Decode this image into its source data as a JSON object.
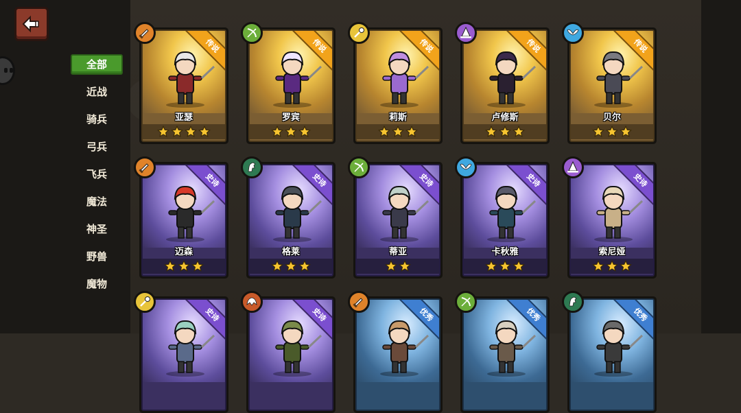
{
  "nav": {
    "back_icon": "back-arrow-icon"
  },
  "categories": [
    "全部",
    "近战",
    "骑兵",
    "弓兵",
    "飞兵",
    "魔法",
    "神圣",
    "野兽",
    "魔物"
  ],
  "active_category": 0,
  "colors": {
    "legend": "#f2a31b",
    "epic": "#7b4fcf",
    "good": "#3f7fd1",
    "category_active": "#4a9a2c"
  },
  "heroes": [
    {
      "name": "亚瑟",
      "rarity": "传说",
      "tier": "legend",
      "class_icon": "sword-icon",
      "stars": 4,
      "hair": "#e8e8e8",
      "outfit": "#8a2a2a"
    },
    {
      "name": "罗宾",
      "rarity": "传说",
      "tier": "legend",
      "class_icon": "bow-icon",
      "stars": 3,
      "hair": "#f0e6ff",
      "outfit": "#5a2a80"
    },
    {
      "name": "莉斯",
      "rarity": "传说",
      "tier": "legend",
      "class_icon": "holy-staff-icon",
      "stars": 3,
      "hair": "#c08ee0",
      "outfit": "#9a6ad0"
    },
    {
      "name": "卢修斯",
      "rarity": "传说",
      "tier": "legend",
      "class_icon": "wizard-hat-icon",
      "stars": 3,
      "hair": "#3a2a4a",
      "outfit": "#2a2030"
    },
    {
      "name": "贝尔",
      "rarity": "传说",
      "tier": "legend",
      "class_icon": "wings-icon",
      "stars": 3,
      "hair": "#7a7a80",
      "outfit": "#4a4a55"
    },
    {
      "name": "迈森",
      "rarity": "史诗",
      "tier": "epic",
      "class_icon": "sword-icon",
      "stars": 3,
      "hair": "#d83a2a",
      "outfit": "#2a2a2a"
    },
    {
      "name": "格莱",
      "rarity": "史诗",
      "tier": "epic",
      "class_icon": "horse-icon",
      "stars": 3,
      "hair": "#4a5058",
      "outfit": "#2a3a4a"
    },
    {
      "name": "蒂亚",
      "rarity": "史诗",
      "tier": "epic",
      "class_icon": "bow-icon",
      "stars": 2,
      "hair": "#c0d0c8",
      "outfit": "#3a3a4a"
    },
    {
      "name": "卡秋雅",
      "rarity": "史诗",
      "tier": "epic",
      "class_icon": "wings-icon",
      "stars": 3,
      "hair": "#5a5a6a",
      "outfit": "#2a4a5a"
    },
    {
      "name": "索尼娅",
      "rarity": "史诗",
      "tier": "epic",
      "class_icon": "wizard-hat-icon",
      "stars": 3,
      "hair": "#e8d8b8",
      "outfit": "#c8b088"
    },
    {
      "name": "",
      "rarity": "史诗",
      "tier": "epic",
      "class_icon": "holy-staff-icon",
      "stars": 0,
      "hair": "#9ad0c0",
      "outfit": "#5a6a8a"
    },
    {
      "name": "",
      "rarity": "史诗",
      "tier": "epic",
      "class_icon": "beast-icon",
      "stars": 0,
      "hair": "#7a8a4a",
      "outfit": "#4a5a2a"
    },
    {
      "name": "",
      "rarity": "优秀",
      "tier": "good",
      "class_icon": "sword-icon",
      "stars": 0,
      "hair": "#c89a6a",
      "outfit": "#6a4a3a"
    },
    {
      "name": "",
      "rarity": "优秀",
      "tier": "good",
      "class_icon": "bow-icon",
      "stars": 0,
      "hair": "#d8d0c0",
      "outfit": "#6a5a4a"
    },
    {
      "name": "",
      "rarity": "优秀",
      "tier": "good",
      "class_icon": "horse-icon",
      "stars": 0,
      "hair": "#6a6a6a",
      "outfit": "#3a3a3a"
    }
  ]
}
